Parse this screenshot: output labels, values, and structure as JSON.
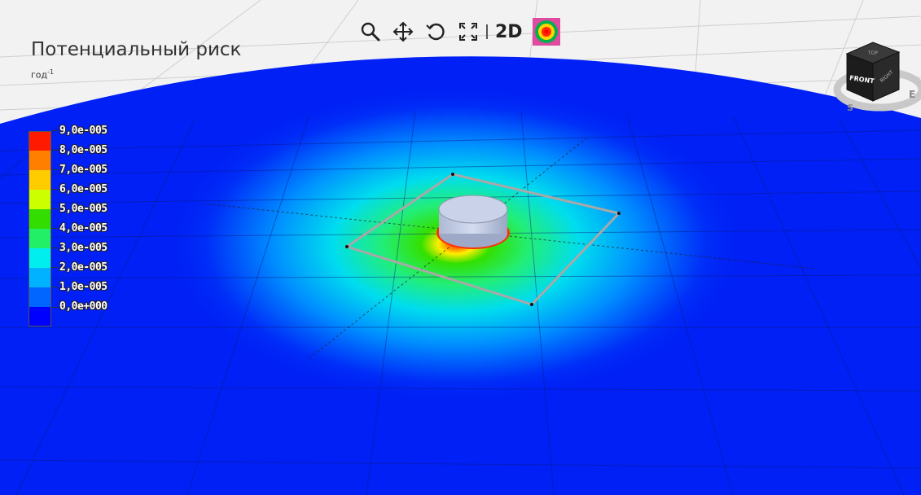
{
  "panel": {
    "title": "Потенциальный риск",
    "units_base": "год",
    "units_exp": "-1"
  },
  "legend": {
    "entries": [
      {
        "label": "9,0e-005",
        "color": "#ff1a00"
      },
      {
        "label": "8,0e-005",
        "color": "#ff7f00"
      },
      {
        "label": "7,0e-005",
        "color": "#ffcc00"
      },
      {
        "label": "6,0e-005",
        "color": "#ccff00"
      },
      {
        "label": "5,0e-005",
        "color": "#33dd00"
      },
      {
        "label": "4,0e-005",
        "color": "#22ee66"
      },
      {
        "label": "3,0e-005",
        "color": "#00eeee"
      },
      {
        "label": "2,0e-005",
        "color": "#00b2ff"
      },
      {
        "label": "1,0e-005",
        "color": "#0066ff"
      }
    ],
    "bottom_label": "0,0e+000",
    "bottom_color": "#0000ff"
  },
  "toolbar": {
    "zoom_icon": "magnifier-icon",
    "pan_icon": "move-arrows-icon",
    "rotate_icon": "rotate-icon",
    "fit_icon": "fit-extent-icon",
    "mode_2d_label": "2D",
    "contour_icon": "risk-contour-icon"
  },
  "navcube": {
    "front_label": "FRONT",
    "top_label": "TOP",
    "right_label": "RIGHT",
    "compass_e": "E",
    "compass_s": "S"
  },
  "colors": {
    "background": "#f2f2f2",
    "ground": "#0020f5",
    "tank": "#c6d0e6",
    "contour_button": "#e04aa0"
  }
}
